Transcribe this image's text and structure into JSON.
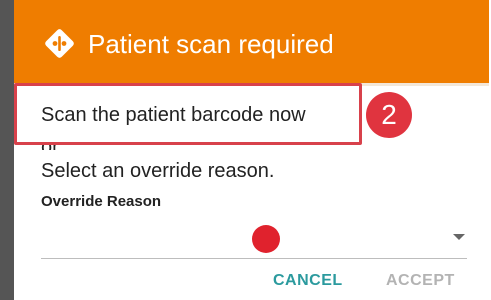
{
  "dialog": {
    "title": "Patient scan required",
    "scan_instruction": "Scan the patient barcode now",
    "or_text": "or",
    "override_prompt": "Select an override reason.",
    "override_label": "Override Reason",
    "override_value": "",
    "cancel_label": "CANCEL",
    "accept_label": "ACCEPT",
    "header_icon": "diamond-alert-icon",
    "header_color": "#ef7d00"
  },
  "annotation": {
    "step_number": "2",
    "marker_color": "#e0343f"
  }
}
